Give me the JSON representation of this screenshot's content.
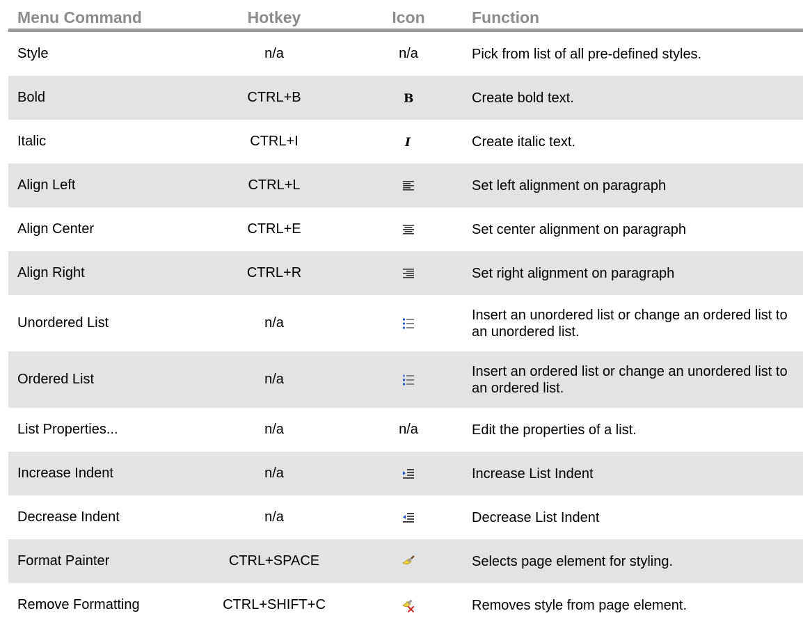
{
  "headers": {
    "menu_command": "Menu Command",
    "hotkey": "Hotkey",
    "icon": "Icon",
    "function": "Function"
  },
  "rows": [
    {
      "command": "Style",
      "hotkey": "n/a",
      "icon_text": "n/a",
      "icon": "none",
      "function": "Pick from list of all pre-defined styles."
    },
    {
      "command": "Bold",
      "hotkey": "CTRL+B",
      "icon": "bold-icon",
      "function": "Create bold text."
    },
    {
      "command": "Italic",
      "hotkey": "CTRL+I",
      "icon": "italic-icon",
      "function": "Create italic text."
    },
    {
      "command": "Align Left",
      "hotkey": "CTRL+L",
      "icon": "align-left-icon",
      "function": "Set left alignment on paragraph"
    },
    {
      "command": "Align Center",
      "hotkey": "CTRL+E",
      "icon": "align-center-icon",
      "function": "Set center alignment on paragraph"
    },
    {
      "command": "Align Right",
      "hotkey": "CTRL+R",
      "icon": "align-right-icon",
      "function": "Set right alignment on paragraph"
    },
    {
      "command": "Unordered List",
      "hotkey": "n/a",
      "icon": "unordered-list-icon",
      "function": "Insert an unordered list or change an ordered list to an unordered list."
    },
    {
      "command": "Ordered List",
      "hotkey": "n/a",
      "icon": "ordered-list-icon",
      "function": "Insert an ordered list or change an unordered list to an ordered list."
    },
    {
      "command": "List Properties...",
      "hotkey": "n/a",
      "icon_text": "n/a",
      "icon": "none",
      "function": "Edit the properties of a list."
    },
    {
      "command": "Increase Indent",
      "hotkey": "n/a",
      "icon": "increase-indent-icon",
      "function": "Increase List Indent"
    },
    {
      "command": "Decrease Indent",
      "hotkey": "n/a",
      "icon": "decrease-indent-icon",
      "function": "Decrease List Indent"
    },
    {
      "command": "Format Painter",
      "hotkey": "CTRL+SPACE",
      "icon": "format-painter-icon",
      "function": "Selects page element for styling."
    },
    {
      "command": "Remove Formatting",
      "hotkey": "CTRL+SHIFT+C",
      "icon": "remove-formatting-icon",
      "function": "Removes style from page element."
    }
  ],
  "colors": {
    "header_text": "#8c8c8c",
    "header_rule": "#9a9a9a",
    "row_shade": "#e3e3e3"
  }
}
